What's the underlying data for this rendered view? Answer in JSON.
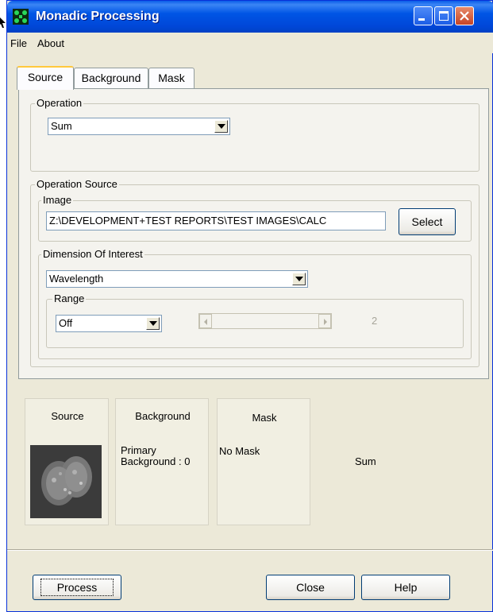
{
  "window": {
    "title": "Monadic Processing"
  },
  "menu": [
    "File",
    "About"
  ],
  "tabs": [
    "Source",
    "Background",
    "Mask"
  ],
  "operation": {
    "group_label": "Operation",
    "selected": "Sum"
  },
  "operation_source": {
    "group_label": "Operation Source",
    "image_group_label": "Image",
    "image_path": "Z:\\DEVELOPMENT+TEST REPORTS\\TEST IMAGES\\CALC",
    "select_label": "Select",
    "dimension_group_label": "Dimension Of Interest",
    "dimension_selected": "Wavelength",
    "range_group_label": "Range",
    "range_selected": "Off",
    "range_value": "2"
  },
  "cards": {
    "source": {
      "title": "Source"
    },
    "background": {
      "title": "Background",
      "text": "Primary\nBackground : 0"
    },
    "mask": {
      "title": "Mask",
      "text": "No Mask"
    },
    "operation_summary": "Sum"
  },
  "buttons": {
    "process": "Process",
    "close": "Close",
    "help": "Help"
  }
}
